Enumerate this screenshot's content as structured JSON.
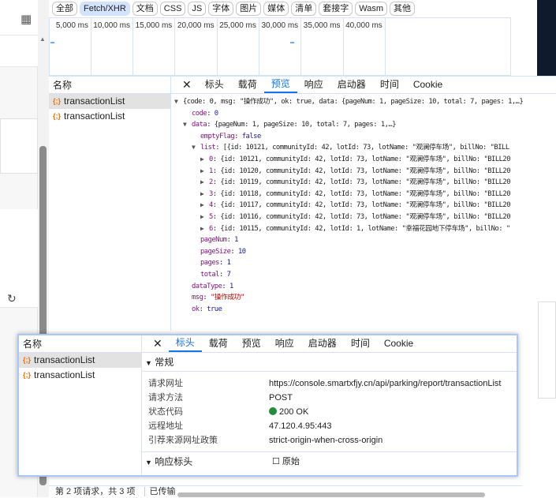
{
  "filter_bar": {
    "buttons": [
      "全部",
      "Fetch/XHR",
      "文档",
      "CSS",
      "JS",
      "字体",
      "图片",
      "媒体",
      "清单",
      "套接字",
      "Wasm",
      "其他"
    ],
    "active": "Fetch/XHR"
  },
  "timeline": {
    "ticks": [
      "5,000 ms",
      "10,000 ms",
      "15,000 ms",
      "20,000 ms",
      "25,000 ms",
      "30,000 ms",
      "35,000 ms",
      "40,000 ms"
    ]
  },
  "name_column": {
    "header": "名称",
    "requests": [
      "transactionList",
      "transactionList"
    ]
  },
  "tabs": [
    "标头",
    "载荷",
    "预览",
    "响应",
    "启动器",
    "时间",
    "Cookie"
  ],
  "preview": {
    "root_summary": "{code: 0, msg: \"操作成功\", ok: true, data: {pageNum: 1, pageSize: 10, total: 7, pages: 1,…}",
    "code": "0",
    "data_summary": "{pageNum: 1, pageSize: 10, total: 7, pages: 1,…}",
    "emptyFlag": "false",
    "list_summary": "[{id: 10121, communityId: 42, lotId: 73, lotName: \"观澜停车场\", billNo: \"BILL",
    "items": [
      {
        "idx": "0",
        "text": "{id: 10121, communityId: 42, lotId: 73, lotName: \"观澜停车场\", billNo: \"BILL20"
      },
      {
        "idx": "1",
        "text": "{id: 10120, communityId: 42, lotId: 73, lotName: \"观澜停车场\", billNo: \"BILL20"
      },
      {
        "idx": "2",
        "text": "{id: 10119, communityId: 42, lotId: 73, lotName: \"观澜停车场\", billNo: \"BILL20"
      },
      {
        "idx": "3",
        "text": "{id: 10118, communityId: 42, lotId: 73, lotName: \"观澜停车场\", billNo: \"BILL20"
      },
      {
        "idx": "4",
        "text": "{id: 10117, communityId: 42, lotId: 73, lotName: \"观澜停车场\", billNo: \"BILL20"
      },
      {
        "idx": "5",
        "text": "{id: 10116, communityId: 42, lotId: 73, lotName: \"观澜停车场\", billNo: \"BILL20"
      },
      {
        "idx": "6",
        "text": "{id: 10115, communityId: 42, lotId: 1, lotName: \"幸福花园地下停车场\", billNo: \""
      }
    ],
    "pageNum": "1",
    "pageSize": "10",
    "pages": "1",
    "total": "7",
    "dataType": "1",
    "msg": "\"操作成功\"",
    "ok": "true"
  },
  "popup": {
    "name_header": "名称",
    "requests": [
      "transactionList",
      "transactionList"
    ],
    "tabs": [
      "标头",
      "载荷",
      "预览",
      "响应",
      "启动器",
      "时间",
      "Cookie"
    ],
    "general_header": "常规",
    "general": [
      {
        "label": "请求网址",
        "value": "https://console.smartxfjy.cn/api/parking/report/transactionList"
      },
      {
        "label": "请求方法",
        "value": "POST"
      },
      {
        "label": "状态代码",
        "value": "200 OK"
      },
      {
        "label": "远程地址",
        "value": "47.120.4.95:443"
      },
      {
        "label": "引荐来源网址政策",
        "value": "strict-origin-when-cross-origin"
      }
    ],
    "response_headers": "响应标头",
    "raw_label": "原始"
  },
  "status_bar": {
    "requests": "第 2 项请求，共 3 项",
    "transferred": "已传输"
  }
}
